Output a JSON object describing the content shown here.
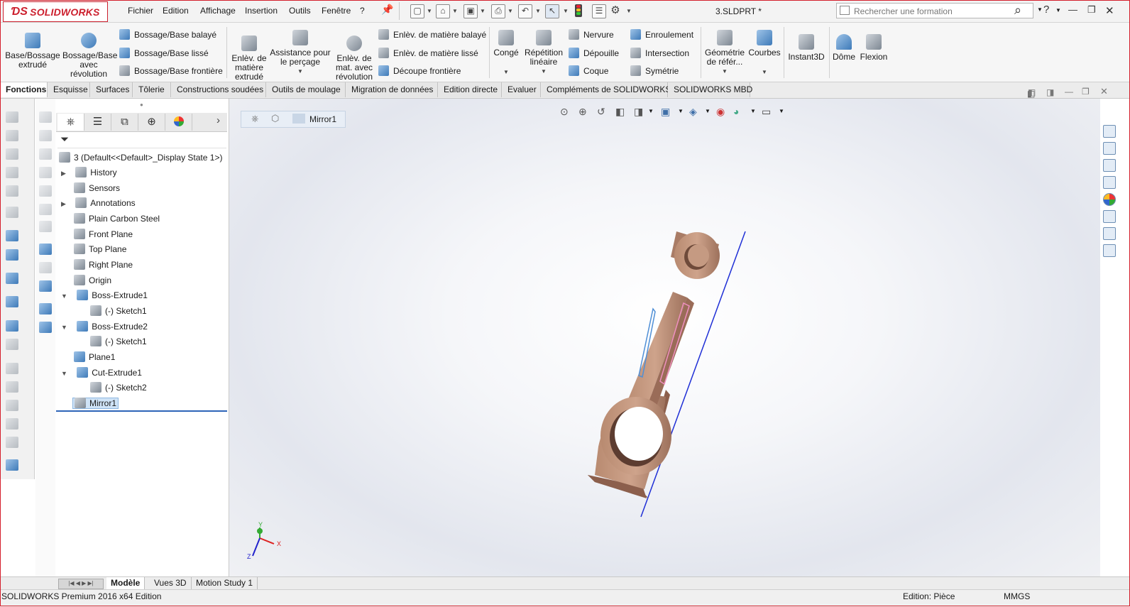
{
  "app": {
    "logo": "SOLIDWORKS",
    "document_title": "3.SLDPRT *"
  },
  "menu": [
    "Fichier",
    "Edition",
    "Affichage",
    "Insertion",
    "Outils",
    "Fenêtre",
    "?"
  ],
  "search": {
    "placeholder": "Rechercher une formation"
  },
  "command_manager": {
    "base_extrude": "Base/Bossage extrudé",
    "revolve": "Bossage/Base avec révolution",
    "sweep": "Bossage/Base balayé",
    "loft": "Bossage/Base lissé",
    "boundary": "Bossage/Base frontière",
    "cut_extrude": "Enlèv. de matière extrudé",
    "hole_wizard": "Assistance pour le perçage",
    "cut_revolve": "Enlèv. de mat. avec révolution",
    "cut_sweep": "Enlèv. de matière balayé",
    "cut_loft": "Enlèv. de matière lissé",
    "cut_boundary": "Découpe frontière",
    "fillet": "Congé",
    "pattern": "Répétition linéaire",
    "rib": "Nervure",
    "draft": "Dépouille",
    "shell": "Coque",
    "wrap": "Enroulement",
    "intersect": "Intersection",
    "mirror": "Symétrie",
    "ref_geometry": "Géométrie de référ...",
    "curves": "Courbes",
    "instant3d": "Instant3D",
    "dome": "Dôme",
    "flex": "Flexion"
  },
  "tabs": [
    "Fonctions",
    "Esquisse",
    "Surfaces",
    "Tôlerie",
    "Constructions soudées",
    "Outils de moulage",
    "Migration de données",
    "Edition directe",
    "Evaluer",
    "Compléments de SOLIDWORKS",
    "SOLIDWORKS MBD"
  ],
  "feature_tree": {
    "root": "3  (Default<<Default>_Display State 1>)",
    "items": [
      "History",
      "Sensors",
      "Annotations",
      "Plain Carbon Steel",
      "Front Plane",
      "Top Plane",
      "Right Plane",
      "Origin",
      "Boss-Extrude1",
      "(-) Sketch1",
      "Boss-Extrude2",
      "(-) Sketch1",
      "Plane1",
      "Cut-Extrude1",
      "(-) Sketch2",
      "Mirror1"
    ]
  },
  "breadcrumb": {
    "label": "Mirror1"
  },
  "triad": {
    "x": "X",
    "y": "Y",
    "z": "Z"
  },
  "bottom_tabs": [
    "Modèle",
    "Vues 3D",
    "Motion Study 1"
  ],
  "status": {
    "left": "SOLIDWORKS Premium 2016 x64 Edition",
    "mode": "Edition: Pièce",
    "units": "MMGS"
  },
  "colors": {
    "part": "#c39a82",
    "part_dark": "#8d6450",
    "frame": "#d41f2c",
    "selection": "#cfe3f7"
  }
}
